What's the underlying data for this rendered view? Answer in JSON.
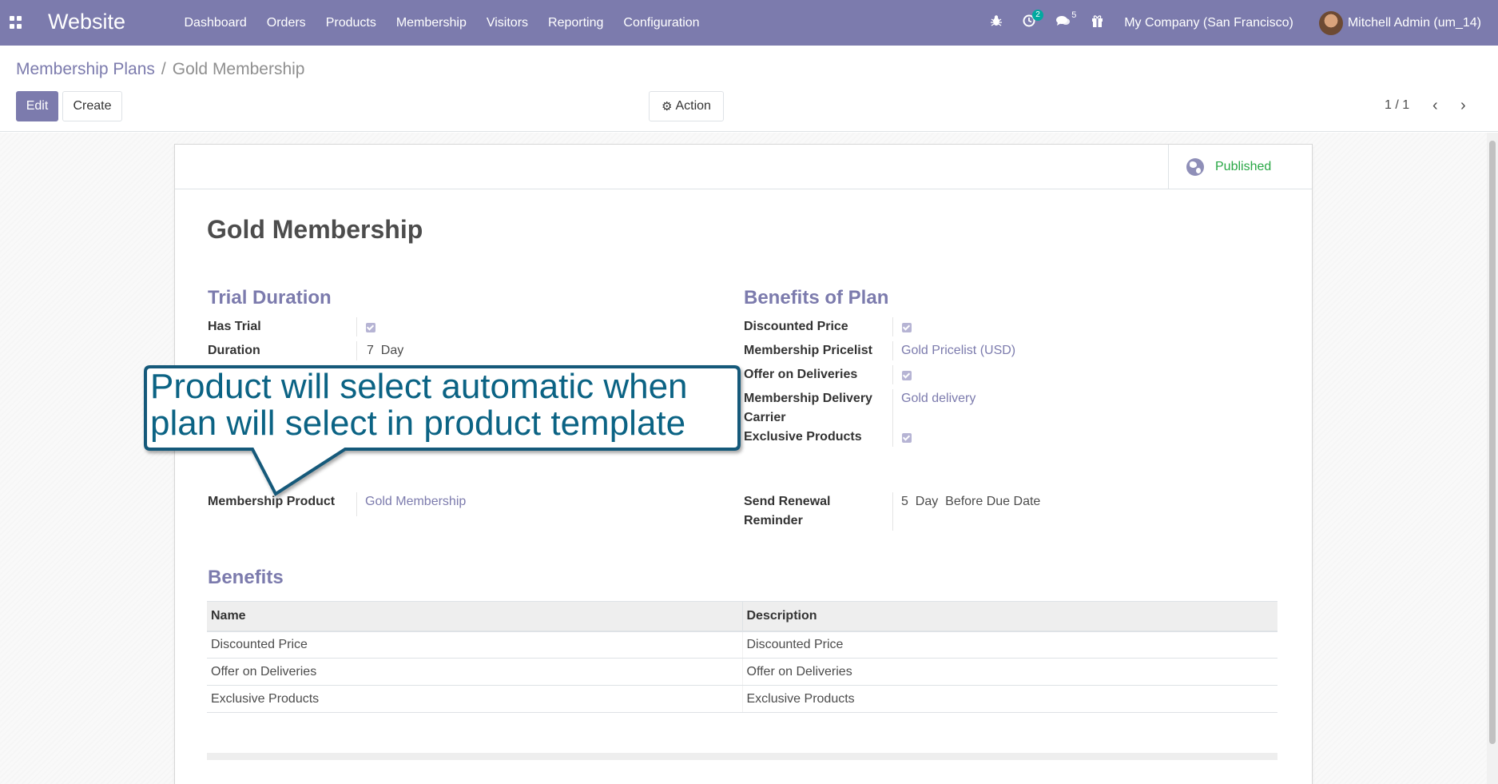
{
  "navbar": {
    "brand": "Website",
    "menu": [
      "Dashboard",
      "Orders",
      "Products",
      "Membership",
      "Visitors",
      "Reporting",
      "Configuration"
    ],
    "activity_badge": "2",
    "messages_badge": "5",
    "company": "My Company (San Francisco)",
    "user": "Mitchell Admin (um_14)"
  },
  "breadcrumb": {
    "parent": "Membership Plans",
    "separator": "/",
    "current": "Gold Membership"
  },
  "buttons": {
    "edit": "Edit",
    "create": "Create",
    "action": "Action"
  },
  "pager": {
    "value": "1 / 1"
  },
  "form": {
    "status": "Published",
    "title": "Gold Membership",
    "trial_group": {
      "title": "Trial Duration",
      "has_trial_label": "Has Trial",
      "has_trial": true,
      "duration_label": "Duration",
      "duration_value": "7",
      "duration_unit": "Day"
    },
    "membership_product_label": "Membership Product",
    "membership_product_value": "Gold Membership",
    "benefits_group": {
      "title": "Benefits of Plan",
      "discounted_price_label": "Discounted Price",
      "discounted_price": true,
      "pricelist_label": "Membership Pricelist",
      "pricelist_value": "Gold Pricelist (USD)",
      "offer_deliveries_label": "Offer on Deliveries",
      "offer_deliveries": true,
      "carrier_label": "Membership Delivery Carrier",
      "carrier_value": "Gold delivery",
      "exclusive_label": "Exclusive Products",
      "exclusive": true
    },
    "renewal_label": "Send Renewal Reminder",
    "renewal_value": "5",
    "renewal_unit": "Day",
    "renewal_suffix": "Before Due Date"
  },
  "benefits": {
    "title": "Benefits",
    "columns": [
      "Name",
      "Description"
    ],
    "rows": [
      [
        "Discounted Price",
        "Discounted Price"
      ],
      [
        "Offer on Deliveries",
        "Offer on Deliveries"
      ],
      [
        "Exclusive Products",
        "Exclusive Products"
      ]
    ]
  },
  "annotation": {
    "text": "Product will select automatic when plan will select in product template",
    "color": "#0b6384"
  },
  "colors": {
    "brand": "#7c7bad",
    "published": "#28a745"
  }
}
